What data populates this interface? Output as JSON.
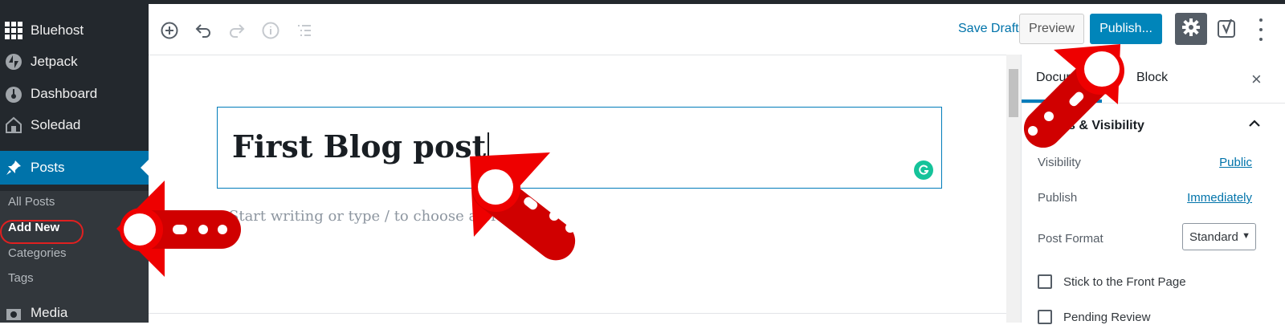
{
  "sidebar": {
    "items": [
      {
        "label": "Bluehost",
        "icon": "grid-icon"
      },
      {
        "label": "Jetpack",
        "icon": "jetpack-icon"
      },
      {
        "label": "Dashboard",
        "icon": "dashboard-icon"
      },
      {
        "label": "Soledad",
        "icon": "soledad-icon"
      },
      {
        "label": "Posts",
        "icon": "pin-icon"
      },
      {
        "label": "Media",
        "icon": "media-icon"
      }
    ],
    "submenu": [
      "All Posts",
      "Add New",
      "Categories",
      "Tags"
    ]
  },
  "toolbar": {
    "save_draft": "Save Draft",
    "preview": "Preview",
    "publish": "Publish...",
    "yoast_label": "y"
  },
  "editor": {
    "title": "First Blog post",
    "placeholder": "Start writing or type / to choose a block"
  },
  "panel": {
    "tab_document": "Document",
    "tab_block": "Block",
    "close": "×",
    "section_title": "Status & Visibility",
    "visibility_label": "Visibility",
    "visibility_value": "Public",
    "publish_label": "Publish",
    "publish_value": "Immediately",
    "format_label": "Post Format",
    "format_value": "Standard",
    "stick_label": "Stick to the Front Page",
    "pending_label": "Pending Review"
  },
  "colors": {
    "sidebar": "#23282d",
    "accent": "#0073aa",
    "publish": "#0085ba",
    "annotation": "#e00000"
  }
}
